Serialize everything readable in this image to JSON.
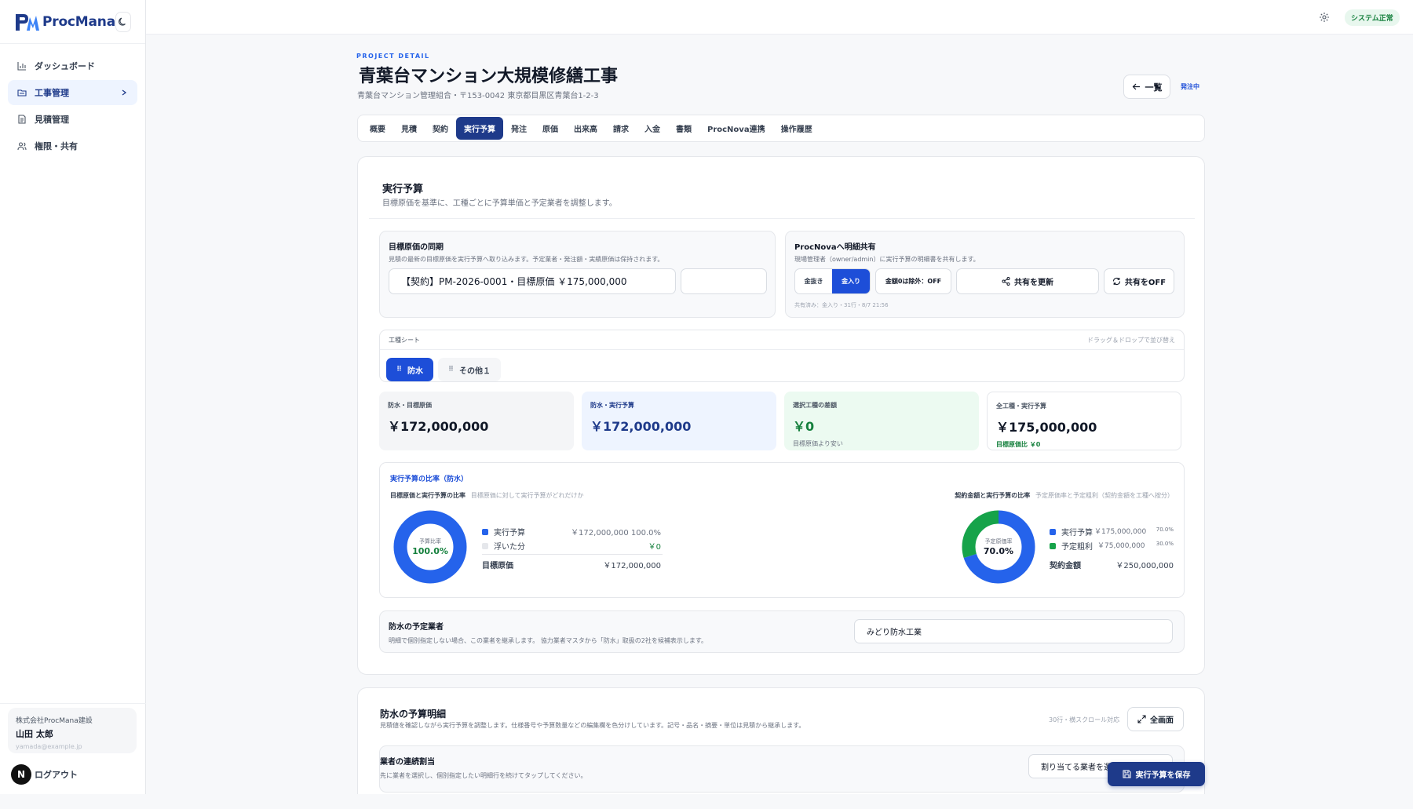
{
  "app": {
    "name": "ProcMana"
  },
  "sidebar": {
    "items": [
      {
        "label": "ダッシュボード",
        "icon": "bar-chart-icon"
      },
      {
        "label": "工事管理",
        "icon": "folder-icon",
        "active": true
      },
      {
        "label": "見積管理",
        "icon": "document-icon"
      },
      {
        "label": "権限・共有",
        "icon": "users-icon"
      }
    ],
    "user": {
      "company": "株式会社ProcMana建設",
      "name": "山田 太郎",
      "email": "yamada@example.jp"
    },
    "logout_label": "ログアウト",
    "avatar_letter": "N"
  },
  "topbar": {
    "status": "システム正常"
  },
  "header": {
    "eyebrow": "PROJECT DETAIL",
    "title": "青葉台マンション大規模修繕工事",
    "subtitle": "青葉台マンション管理組合・〒153-0042 東京都目黒区青葉台1-2-3",
    "back_label": "一覧",
    "status": "発注中"
  },
  "tabs": [
    "概要",
    "見積",
    "契約",
    "実行予算",
    "発注",
    "原価",
    "出来高",
    "請求",
    "入金",
    "書類",
    "ProcNova連携",
    "操作履歴"
  ],
  "active_tab": "実行予算",
  "budget": {
    "title": "実行予算",
    "desc": "目標原価を基準に、工種ごとに予算単価と予定業者を調整します。",
    "sync": {
      "title": "目標原価の同期",
      "desc": "見積の最新の目標原価を実行予算へ取り込みます。予定業者・発注額・実績原価は保持されます。",
      "selected": "【契約】PM-2026-0001・目標原価 ￥175,000,000"
    },
    "share": {
      "title": "ProcNovaへ明細共有",
      "desc": "現場管理者（owner/admin）に実行予算の明細書を共有します。",
      "seg": [
        "金抜き",
        "金入り"
      ],
      "seg_active": "金入り",
      "exclude_zero": "金額0は除外：OFF",
      "update_label": "共有を更新",
      "off_label": "共有をOFF",
      "status": "共有済み：金入り・31行・8/7 21:56"
    },
    "sheets": {
      "label": "工種シート",
      "hint": "ドラッグ＆ドロップで並び替え",
      "items": [
        "防水",
        "その他１"
      ],
      "active": "防水"
    },
    "stats": [
      {
        "label": "防水・目標原価",
        "value": "￥172,000,000",
        "note": ""
      },
      {
        "label": "防水・実行予算",
        "value": "￥172,000,000",
        "note": ""
      },
      {
        "label": "選択工種の差額",
        "value": "￥0",
        "note": "目標原価より安い"
      },
      {
        "label": "全工種・実行予算",
        "value": "￥175,000,000",
        "note": "目標原価比 ￥0"
      }
    ],
    "ratio": {
      "title": "実行予算の比率（防水）",
      "left": {
        "heading": "目標原価と実行予算の比率",
        "subheading": "目標原価に対して実行予算がどれだけか",
        "center_label": "予算比率",
        "center_value": "100.0%",
        "rows": [
          {
            "label": "実行予算",
            "amount": "￥172,000,000 100.0%",
            "color": "#2563eb",
            "ratio": 1.0
          },
          {
            "label": "浮いた分",
            "amount": "￥0",
            "color": "#e5e7eb",
            "ratio": 0.0
          }
        ],
        "total_label": "目標原価",
        "total_amount": "￥172,000,000"
      },
      "right": {
        "heading": "契約金額と実行予算の比率",
        "subheading": "予定原価率と予定粗利（契約金額を工種へ按分）",
        "center_label": "予定原価率",
        "center_value": "70.0%",
        "rows": [
          {
            "label": "実行予算",
            "amount": "￥175,000,000",
            "pct": "70.0%",
            "color": "#2563eb",
            "ratio": 0.7
          },
          {
            "label": "予定粗利",
            "amount": "￥75,000,000",
            "pct": "30.0%",
            "color": "#16a34a",
            "ratio": 0.3
          }
        ],
        "total_label": "契約金額",
        "total_amount": "￥250,000,000"
      }
    },
    "vendor": {
      "title": "防水の予定業者",
      "desc": "明細で個別指定しない場合、この業者を継承します。 協力業者マスタから「防水」取扱の2社を候補表示します。",
      "selected": "みどり防水工業"
    }
  },
  "detail": {
    "title": "防水の予算明細",
    "desc": "見積値を確認しながら実行予算を調整します。仕様番号や予算数量などの編集欄を色分けしています。記号・品名・摘要・単位は見積から継承します。",
    "meta": "30行・横スクロール対応",
    "fullscreen_label": "全画面",
    "bulk": {
      "title": "業者の連続割当",
      "desc": "先に業者を選択し、個別指定したい明細行を続けてタップしてください。",
      "placeholder": "割り当てる業者を選択"
    }
  },
  "save_label": "実行予算を保存"
}
